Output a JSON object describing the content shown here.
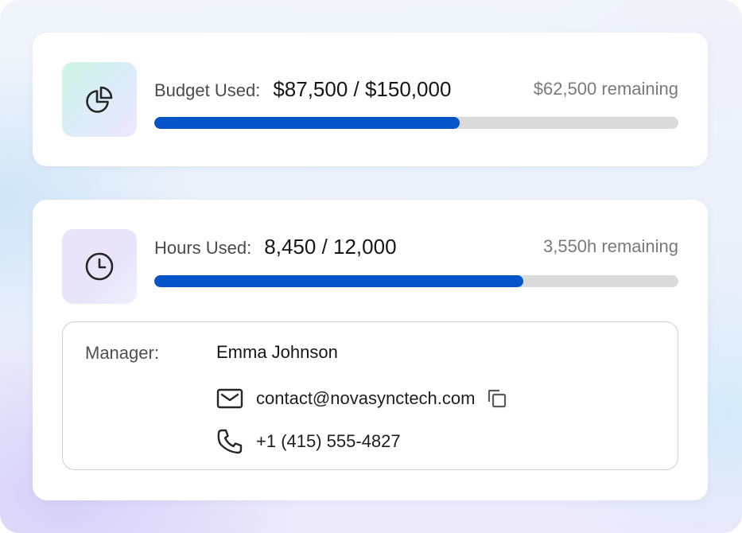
{
  "budget": {
    "icon": "pie-chart-icon",
    "label": "Budget Used:",
    "value": "$87,500 / $150,000",
    "remaining": "$62,500 remaining",
    "progress_fraction": 0.5833,
    "bar_color": "#0455c9"
  },
  "hours": {
    "icon": "clock-icon",
    "label": "Hours Used:",
    "value": "8,450 / 12,000",
    "remaining": "3,550h remaining",
    "progress_fraction": 0.7042,
    "bar_color": "#0455c9"
  },
  "manager": {
    "label": "Manager:",
    "name": "Emma Johnson",
    "email": "contact@novasynctech.com",
    "email_icon": "mail-icon",
    "copy_icon": "copy-icon",
    "phone": "+1 (415) 555-4827",
    "phone_icon": "phone-icon"
  }
}
